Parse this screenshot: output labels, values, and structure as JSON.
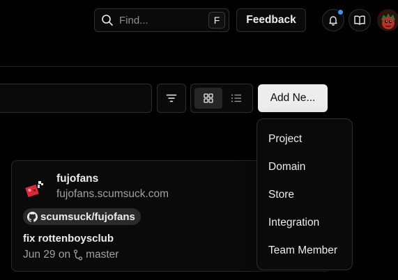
{
  "header": {
    "search": {
      "placeholder": "Find...",
      "shortcut": "F"
    },
    "feedback_label": "Feedback",
    "notifications": {
      "has_unread": true,
      "dot_color": "#3b95f0"
    },
    "docs_icon": "book-icon",
    "avatar_icon": "user-avatar"
  },
  "toolbar": {
    "filter_icon": "filter-icon",
    "view_modes": [
      "grid",
      "list"
    ],
    "active_view": "grid",
    "add_new_label": "Add Ne..."
  },
  "add_new_menu": {
    "items": [
      "Project",
      "Domain",
      "Store",
      "Integration",
      "Team Member"
    ]
  },
  "project_card": {
    "name": "fujofans",
    "domain": "fujofans.scumsuck.com",
    "repo": "scumsuck/fujofans",
    "commit_message": "fix rottenboysclub",
    "commit_date": "Jun 29 on",
    "branch": "master"
  },
  "colors": {
    "background": "#000000",
    "accent_dot": "#3b95f0",
    "primary_button": "#ededed"
  }
}
